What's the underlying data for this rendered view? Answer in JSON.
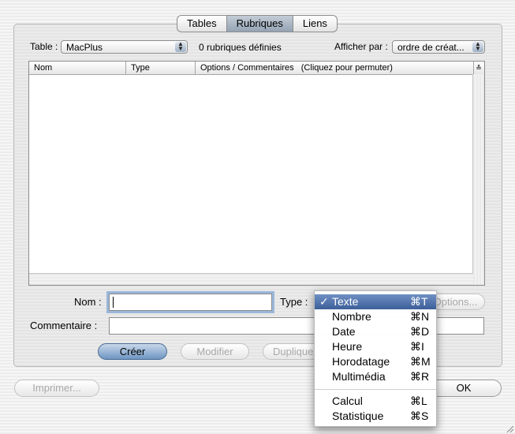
{
  "tabs": [
    {
      "label": "Tables",
      "selected": false
    },
    {
      "label": "Rubriques",
      "selected": true
    },
    {
      "label": "Liens",
      "selected": false
    }
  ],
  "table_selector": {
    "label": "Table :",
    "value": "MacPlus"
  },
  "count_text": "0 rubriques définies",
  "sort_selector": {
    "label": "Afficher par :",
    "value": "ordre de créat..."
  },
  "columns": [
    "Nom",
    "Type",
    "Options / Commentaires   (Cliquez pour permuter)"
  ],
  "form": {
    "name_label": "Nom :",
    "name_value": "",
    "type_label": "Type :",
    "options_label": "Options...",
    "comment_label": "Commentaire :",
    "comment_value": ""
  },
  "actions": {
    "create": "Créer",
    "modify": "Modifier",
    "duplicate": "Duplique"
  },
  "footer": {
    "print": "Imprimer...",
    "ok": "OK"
  },
  "type_menu": {
    "items": [
      {
        "label": "Texte",
        "shortcut": "⌘T",
        "checked": true
      },
      {
        "label": "Nombre",
        "shortcut": "⌘N"
      },
      {
        "label": "Date",
        "shortcut": "⌘D"
      },
      {
        "label": "Heure",
        "shortcut": "⌘I"
      },
      {
        "label": "Horodatage",
        "shortcut": "⌘M"
      },
      {
        "label": "Multimédia",
        "shortcut": "⌘R"
      },
      {
        "label": "Calcul",
        "shortcut": "⌘L"
      },
      {
        "label": "Statistique",
        "shortcut": "⌘S"
      }
    ],
    "check_glyph": "✓"
  },
  "icons": {
    "popup_arrows": "up-down-arrows",
    "sort": "sort-order-icon"
  }
}
